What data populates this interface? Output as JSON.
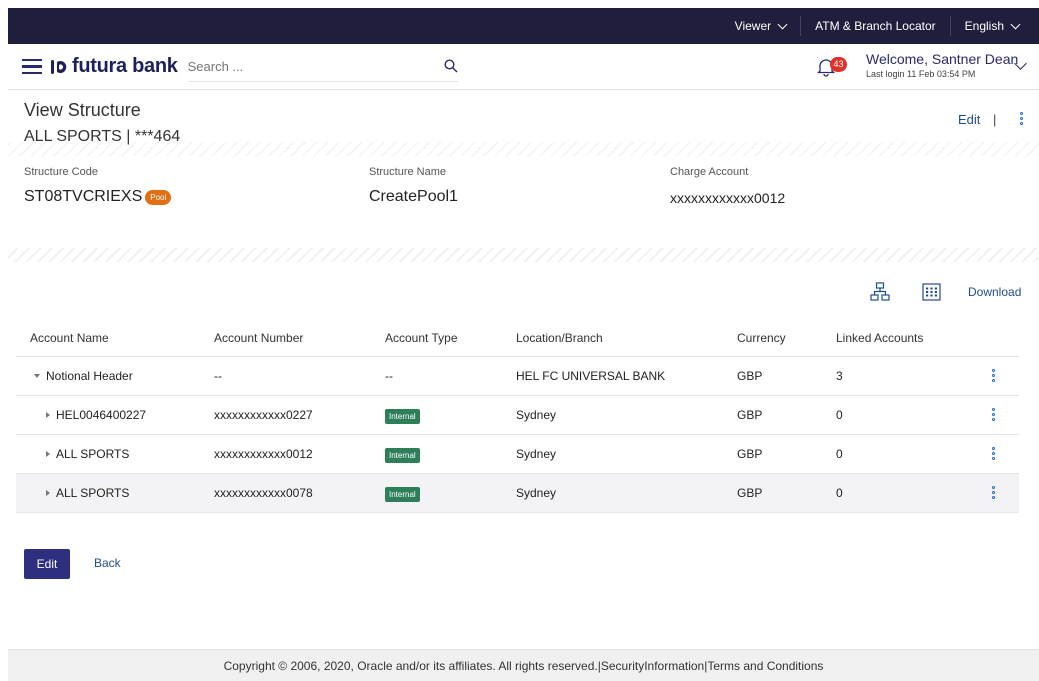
{
  "topbar": {
    "viewer_label": "Viewer",
    "atm_label": "ATM & Branch Locator",
    "language_label": "English"
  },
  "header": {
    "brand": "futura bank",
    "search_placeholder": "Search ...",
    "notification_count": "43",
    "welcome_text": "Welcome, Santner Dean",
    "last_login": "Last login 11 Feb 03:54 PM"
  },
  "page": {
    "title": "View Structure",
    "subtitle": "ALL SPORTS | ***464",
    "edit_label": "Edit",
    "pipe": "|"
  },
  "details": {
    "structure_code_label": "Structure Code",
    "structure_code_value": "ST08TVCRIEXS",
    "pool_badge": "Pool",
    "structure_name_label": "Structure Name",
    "structure_name_value": "CreatePool1",
    "charge_account_label": "Charge Account",
    "charge_account_value": "xxxxxxxxxxxx0012"
  },
  "toolbar": {
    "download_label": "Download"
  },
  "table": {
    "headers": [
      "Account Name",
      "Account Number",
      "Account Type",
      "Location/Branch",
      "Currency",
      "Linked Accounts"
    ],
    "rows": [
      {
        "name": "Notional Header",
        "number": "--",
        "type": "--",
        "type_badge": false,
        "location": "HEL FC UNIVERSAL BANK",
        "currency": "GBP",
        "linked": "3",
        "expanded": true
      },
      {
        "name": "HEL0046400227",
        "number": "xxxxxxxxxxxx0227",
        "type": "Internal",
        "type_badge": true,
        "location": "Sydney",
        "currency": "GBP",
        "linked": "0",
        "expanded": false
      },
      {
        "name": "ALL SPORTS",
        "number": "xxxxxxxxxxxx0012",
        "type": "Internal",
        "type_badge": true,
        "location": "Sydney",
        "currency": "GBP",
        "linked": "0",
        "expanded": false
      },
      {
        "name": "ALL SPORTS",
        "number": "xxxxxxxxxxxx0078",
        "type": "Internal",
        "type_badge": true,
        "location": "Sydney",
        "currency": "GBP",
        "linked": "0",
        "expanded": false
      }
    ]
  },
  "actions": {
    "edit_label": "Edit",
    "back_label": "Back"
  },
  "footer": {
    "text": "Copyright © 2006, 2020, Oracle and/or its affiliates. All rights reserved.|SecurityInformation|Terms and Conditions"
  },
  "colors": {
    "topbar_bg": "#1f1f3d",
    "brand": "#1f1f5c",
    "primary_button": "#2e2f7f",
    "link": "#1f4e8c",
    "pool_badge": "#e07013",
    "internal_badge": "#2e7e5a",
    "notification_badge": "#e0302a"
  },
  "icons": {
    "menu": "hamburger-icon",
    "search": "search-icon",
    "notifications": "bell-icon",
    "tree_view": "hierarchy-icon",
    "grid_view": "grid-icon",
    "row_actions": "kebab-icon"
  }
}
